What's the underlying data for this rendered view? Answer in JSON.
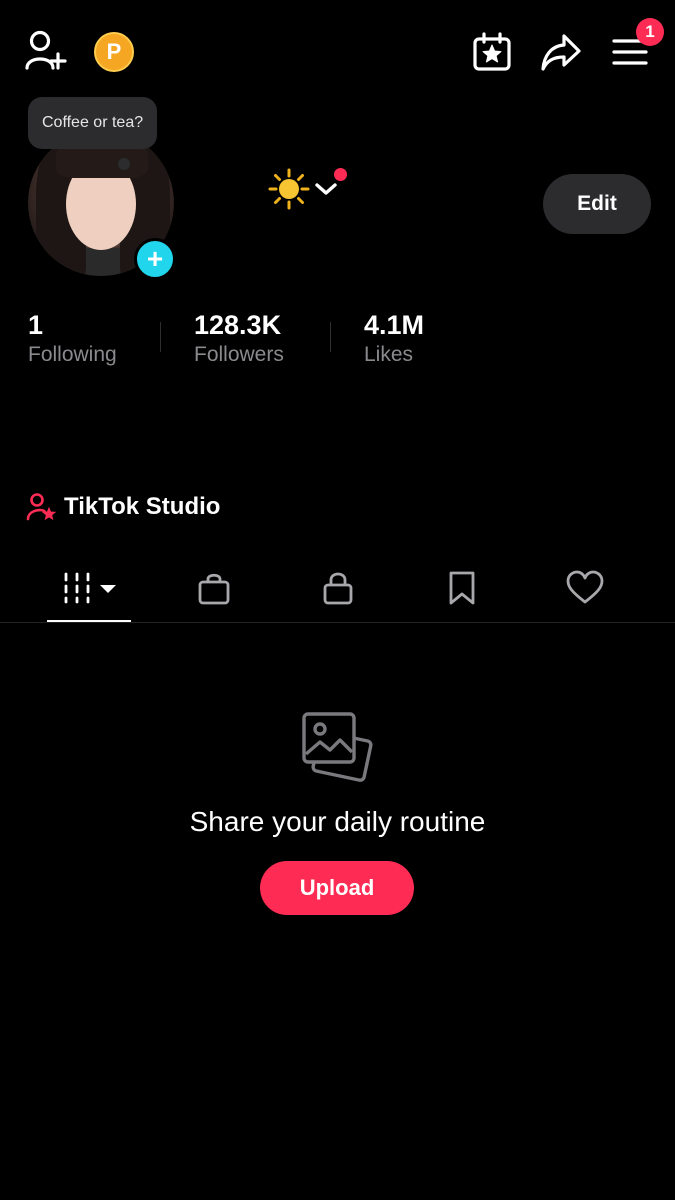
{
  "topbar": {
    "icons": [
      "add-friend-icon",
      "points-coin-icon",
      "calendar-star-icon",
      "share-icon",
      "menu-icon"
    ],
    "coin_letter": "P",
    "menu_badge": "1",
    "accent": "#fe2c55"
  },
  "profile": {
    "note": "Coffee or tea?",
    "status_emoji": "☀️",
    "edit_label": "Edit",
    "avatar_badge": "+"
  },
  "stats": [
    {
      "value": "1",
      "label": "Following"
    },
    {
      "value": "128.3K",
      "label": "Followers"
    },
    {
      "value": "4.1M",
      "label": "Likes"
    }
  ],
  "studio": {
    "label": "TikTok Studio",
    "icon": "creator-star-icon"
  },
  "tabs": [
    {
      "icon": "videos-grid-icon",
      "active": true
    },
    {
      "icon": "shopping-bag-icon",
      "active": false
    },
    {
      "icon": "lock-icon",
      "active": false
    },
    {
      "icon": "bookmark-icon",
      "active": false
    },
    {
      "icon": "heart-icon",
      "active": false
    }
  ],
  "empty_state": {
    "icon": "photos-icon",
    "title": "Share your daily routine",
    "button": "Upload"
  },
  "colors": {
    "background": "#000000",
    "accent": "#fe2c55",
    "cyan": "#20d5ec",
    "muted": "#8a8a8e"
  }
}
